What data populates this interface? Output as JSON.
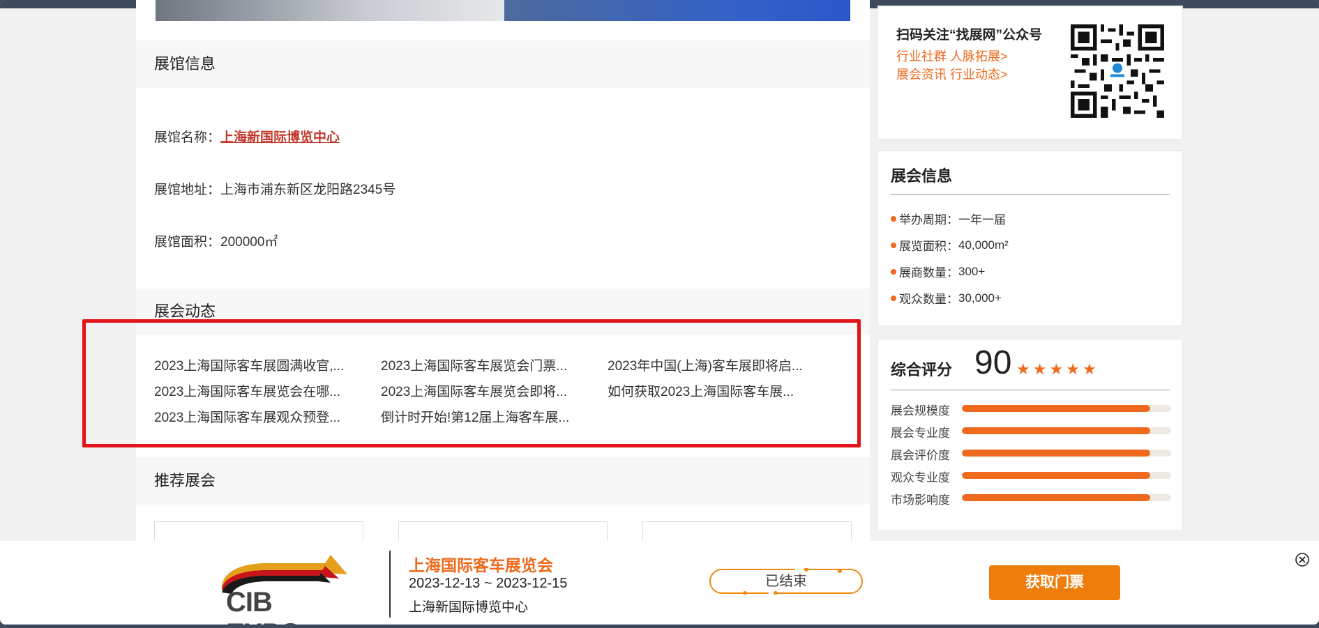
{
  "venue_section": {
    "heading": "展馆信息",
    "name_label": "展馆名称：",
    "name_value": "上海新国际博览中心",
    "address_label": "展馆地址：",
    "address_value": "上海市浦东新区龙阳路2345号",
    "area_label": "展馆面积：",
    "area_value": "200000㎡"
  },
  "news_section": {
    "heading": "展会动态",
    "items": [
      "2023上海国际客车展圆满收官,...",
      "2023上海国际客车展览会门票...",
      "2023年中国(上海)客车展即将启...",
      "2023上海国际客车展览会在哪...",
      "2023上海国际客车展览会即将...",
      "如何获取2023上海国际客车展...",
      "2023上海国际客车展观众预登...",
      "倒计时开始!第12届上海客车展..."
    ]
  },
  "recommend_section": {
    "heading": "推荐展会"
  },
  "sidebar": {
    "qr": {
      "title": "扫码关注“找展网”公众号",
      "link1": "行业社群 人脉拓展>",
      "link2": "展会资讯 行业动态>"
    },
    "expo_info": {
      "title": "展会信息",
      "facts": [
        {
          "label": "举办周期：",
          "value": "一年一届"
        },
        {
          "label": "展览面积：",
          "value": "40,000m²"
        },
        {
          "label": "展商数量：",
          "value": "300+"
        },
        {
          "label": "观众数量：",
          "value": "30,000+"
        }
      ]
    },
    "score": {
      "title": "综合评分",
      "value": "90",
      "stars": 5,
      "ratings": [
        {
          "label": "展会规模度",
          "level": 0.9
        },
        {
          "label": "展会专业度",
          "level": 0.9
        },
        {
          "label": "展会评价度",
          "level": 0.9
        },
        {
          "label": "观众专业度",
          "level": 0.9
        },
        {
          "label": "市场影响度",
          "level": 0.9
        }
      ]
    }
  },
  "bottom_bar": {
    "logo_text": "CIB EXPO",
    "expo_name": "上海国际客车展览会",
    "expo_dates": "2023-12-13 ~ 2023-12-15",
    "expo_venue": "上海新国际博览中心",
    "status": "已结束",
    "ticket_button": "获取门票",
    "accent_color": "#ef7d0b"
  }
}
